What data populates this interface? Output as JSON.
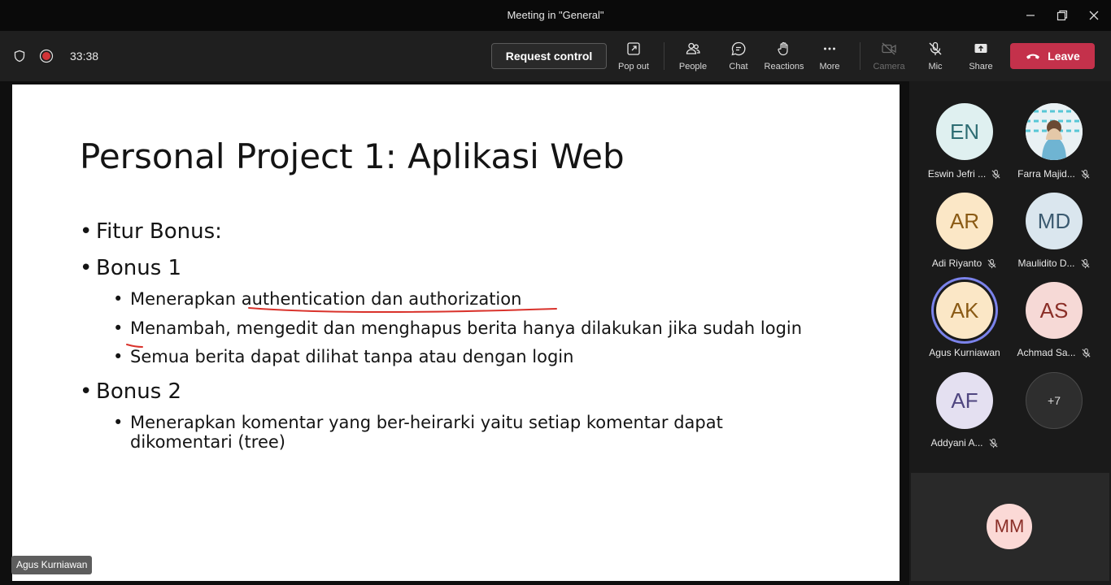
{
  "window": {
    "title": "Meeting in \"General\""
  },
  "toolbar": {
    "timer": "33:38",
    "request_control": "Request control",
    "pop_out": "Pop out",
    "people": "People",
    "chat": "Chat",
    "reactions": "Reactions",
    "more": "More",
    "camera": "Camera",
    "mic": "Mic",
    "share": "Share",
    "leave": "Leave",
    "leave_color": "#c4314b"
  },
  "slide": {
    "title": "Personal Project 1: Aplikasi Web",
    "bullets": [
      "Fitur Bonus:",
      "Bonus 1",
      "Menerapkan authentication dan authorization",
      "Menambah, mengedit dan menghapus berita hanya dilakukan jika sudah login",
      "Semua berita dapat dilihat tanpa atau dengan login",
      "Bonus 2",
      "Menerapkan komentar yang ber-heirarki yaitu setiap komentar dapat",
      "dikomentari (tree)"
    ],
    "annotation_color": "#d9322b",
    "presenter": "Agus Kurniawan"
  },
  "participants": [
    {
      "initials": "EN",
      "name": "Eswin Jefri ...",
      "bg": "#dff0f0",
      "fg": "#2e6d73"
    },
    {
      "initials": "",
      "name": "Farra Majid...",
      "bg": "#f0f0f0",
      "fg": "#333"
    },
    {
      "initials": "AR",
      "name": "Adi Riyanto",
      "bg": "#fbe7c6",
      "fg": "#8a5a14"
    },
    {
      "initials": "MD",
      "name": "Maulidito D...",
      "bg": "#dae6ee",
      "fg": "#3b5a70"
    },
    {
      "initials": "AK",
      "name": "Agus Kurniawan",
      "bg": "#fbe7c6",
      "fg": "#8a5a14"
    },
    {
      "initials": "AS",
      "name": "Achmad Sa...",
      "bg": "#f6d9d6",
      "fg": "#8a2e27"
    },
    {
      "initials": "AF",
      "name": "Addyani A...",
      "bg": "#e4e0f1",
      "fg": "#4f4680"
    },
    {
      "initials": "+7",
      "name": ""
    }
  ],
  "self": {
    "initials": "MM",
    "bg": "#fbd9d6",
    "fg": "#8a2e27"
  }
}
